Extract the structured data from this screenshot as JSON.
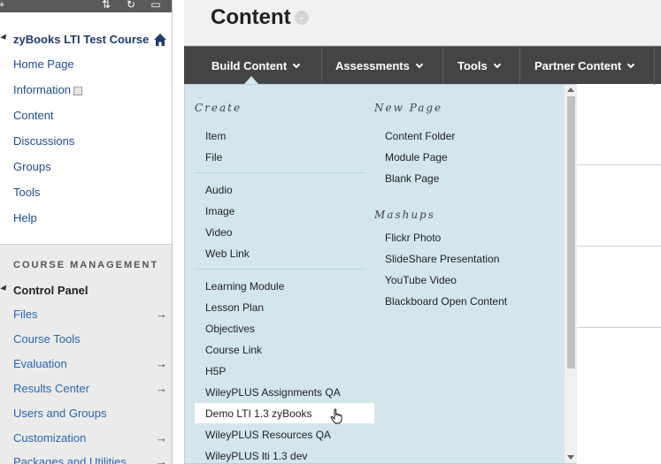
{
  "sidebar": {
    "course_title": "zyBooks LTI Test Course",
    "nav_items": [
      "Home Page",
      "Information",
      "Content",
      "Discussions",
      "Groups",
      "Tools",
      "Help"
    ],
    "course_management": {
      "heading": "COURSE MANAGEMENT",
      "control_panel": "Control Panel",
      "items": [
        {
          "label": "Files",
          "arrow": "→"
        },
        {
          "label": "Course Tools",
          "arrow": ""
        },
        {
          "label": "Evaluation",
          "arrow": "→"
        },
        {
          "label": "Results Center",
          "arrow": "→"
        },
        {
          "label": "Users and Groups",
          "arrow": ""
        },
        {
          "label": "Customization",
          "arrow": "→"
        },
        {
          "label": "Packages and Utilities",
          "arrow": "→"
        }
      ]
    },
    "toolbar_icons": [
      "add-icon",
      "sort-icon",
      "refresh-icon",
      "collapse-icon"
    ]
  },
  "header": {
    "title": "Content"
  },
  "action_bar": {
    "buttons": [
      "Build Content",
      "Assessments",
      "Tools",
      "Partner Content"
    ]
  },
  "dropdown": {
    "create_heading": "Create",
    "create_groups": [
      [
        "Item",
        "File"
      ],
      [
        "Audio",
        "Image",
        "Video",
        "Web Link"
      ],
      [
        "Learning Module",
        "Lesson Plan",
        "Objectives",
        "Course Link",
        "H5P",
        "WileyPLUS Assignments QA",
        "Demo LTI 1.3 zyBooks",
        "WileyPLUS Resources QA",
        "WileyPLUS lti 1.3 dev"
      ]
    ],
    "new_page_heading": "New Page",
    "new_page_items": [
      "Content Folder",
      "Module Page",
      "Blank Page"
    ],
    "mashups_heading": "Mashups",
    "mashups_items": [
      "Flickr Photo",
      "SlideShare Presentation",
      "YouTube Video",
      "Blackboard Open Content"
    ],
    "highlighted_item": "Demo LTI 1.3 zyBooks"
  },
  "colors": {
    "dropdown_bg": "#d3e6ee",
    "action_bar_bg": "#444444",
    "link_blue": "#2a66b0",
    "sidebar_bg": "#ebebeb"
  }
}
